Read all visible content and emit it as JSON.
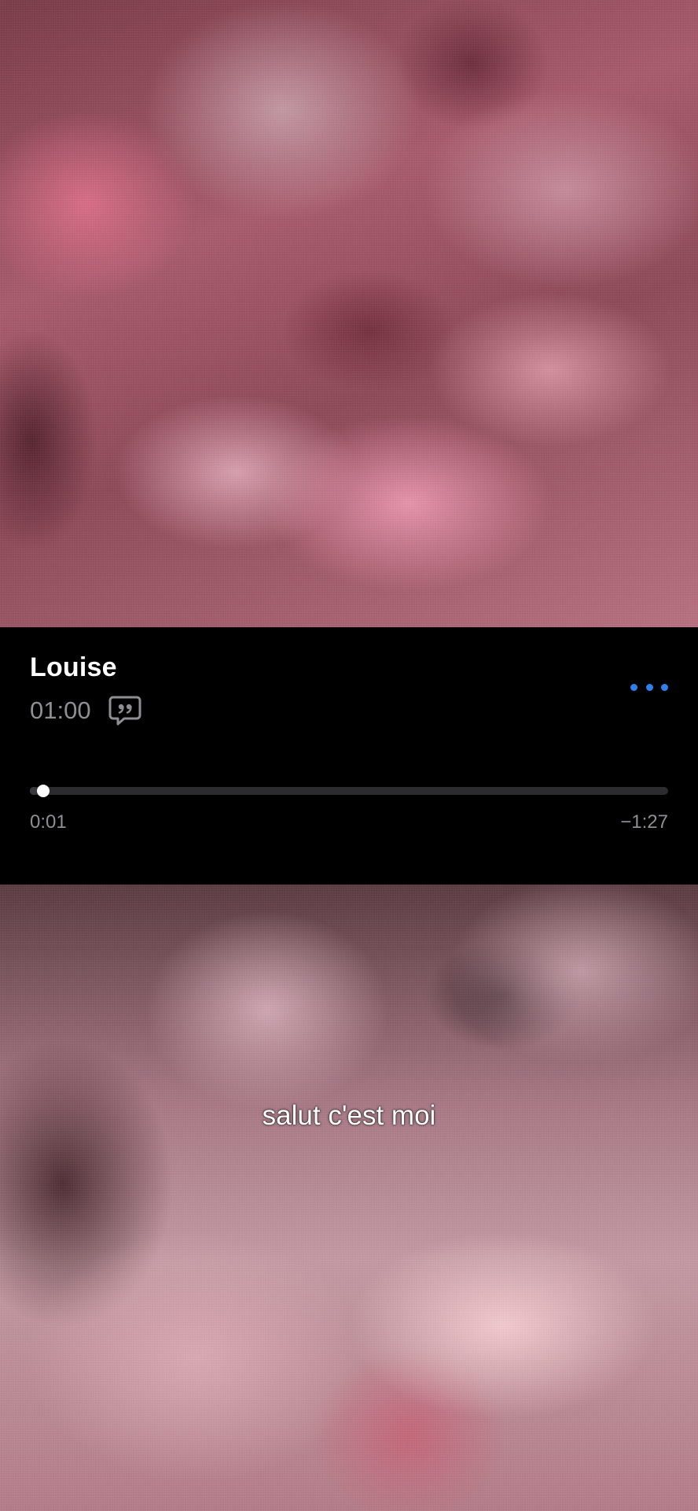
{
  "memo": {
    "title": "Louise",
    "duration": "01:00",
    "transcript_icon": "quote-bubble-icon",
    "more_icon": "ellipsis-icon",
    "accent_color": "#2f80ed",
    "playback": {
      "elapsed": "0:01",
      "remaining": "−1:27",
      "progress_fraction": 0.011
    }
  },
  "caption": {
    "text": "salut c'est moi"
  },
  "background": {
    "image": "pink-roses-photo"
  }
}
